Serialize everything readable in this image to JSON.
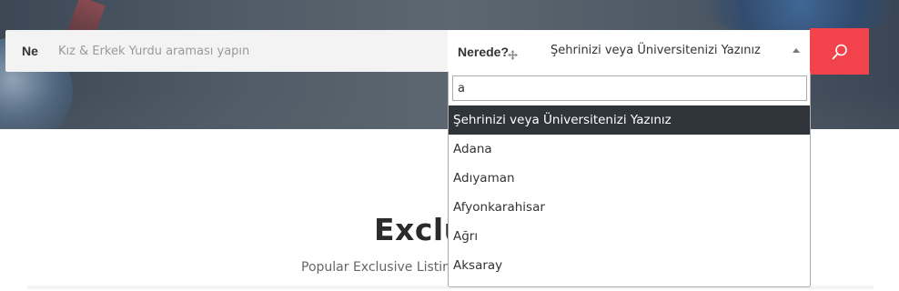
{
  "search": {
    "what_label": "Ne",
    "what_placeholder": "Kız & Erkek Yurdu araması yapın",
    "what_value": "",
    "where_label": "Nerede?",
    "where_selected": "Şehrinizi veya Üniversitenizi Yazınız",
    "button_icon": "search-icon"
  },
  "dropdown": {
    "query": "a",
    "options": [
      "Şehrinizi veya Üniversitenizi Yazınız",
      "Adana",
      "Adıyaman",
      "Afyonkarahisar",
      "Ağrı",
      "Aksaray"
    ],
    "highlighted_index": 0
  },
  "section": {
    "title": "Exclusive",
    "subtitle": "Popular Exclusive Listings"
  },
  "colors": {
    "accent": "#f2434c",
    "highlight": "#2f343a"
  }
}
